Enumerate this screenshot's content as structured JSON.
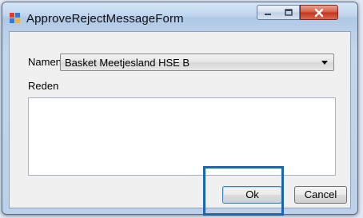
{
  "window": {
    "title": "ApproveRejectMessageForm",
    "controls": {
      "minimize_icon": "minimize-icon",
      "maximize_icon": "maximize-icon",
      "close_icon": "close-icon"
    }
  },
  "form": {
    "namens_label": "Namens",
    "namens_value": "Basket Meetjesland HSE B",
    "reden_label": "Reden",
    "reden_value": ""
  },
  "buttons": {
    "ok": "Ok",
    "cancel": "Cancel"
  },
  "colors": {
    "highlight": "#1a67b0",
    "close_button": "#c1331b"
  }
}
